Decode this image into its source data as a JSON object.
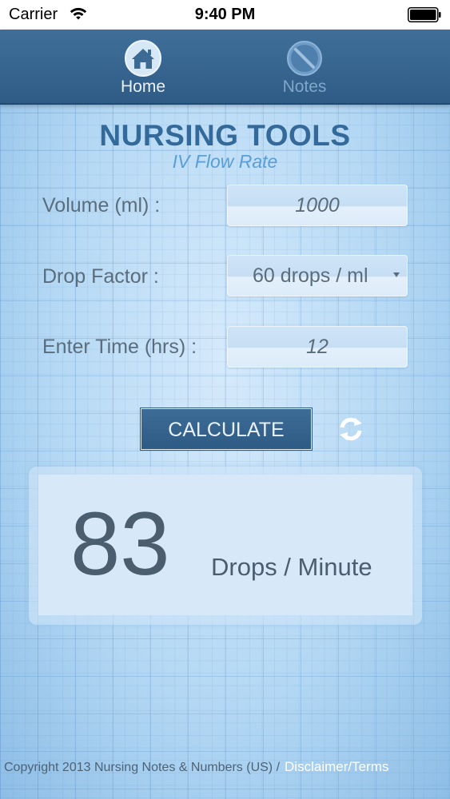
{
  "status_bar": {
    "carrier": "Carrier",
    "time": "9:40 PM",
    "wifi_icon": "wifi-icon",
    "battery_icon": "battery-icon"
  },
  "nav": {
    "items": [
      {
        "label": "Home",
        "icon": "home-icon",
        "active": true
      },
      {
        "label": "Notes",
        "icon": "notes-icon",
        "active": false
      }
    ]
  },
  "header": {
    "title": "NURSING TOOLS",
    "subtitle": "IV Flow Rate"
  },
  "form": {
    "volume": {
      "label": "Volume (ml) :",
      "value": "1000"
    },
    "drop_factor": {
      "label": "Drop Factor :",
      "value": "60 drops / ml"
    },
    "time": {
      "label": "Enter Time (hrs) :",
      "value": "12"
    }
  },
  "actions": {
    "calculate_label": "CALCULATE",
    "reset_icon": "refresh-icon"
  },
  "result": {
    "value": "83",
    "unit": "Drops / Minute"
  },
  "footer": {
    "copyright": "Copyright 2013 Nursing Notes & Numbers (US) /",
    "link": "Disclaimer/Terms"
  },
  "colors": {
    "nav_bar": "#346690",
    "title": "#346a9a",
    "subtitle": "#5a9ed6",
    "button": "#34628c",
    "result_text": "#4b5e70"
  }
}
